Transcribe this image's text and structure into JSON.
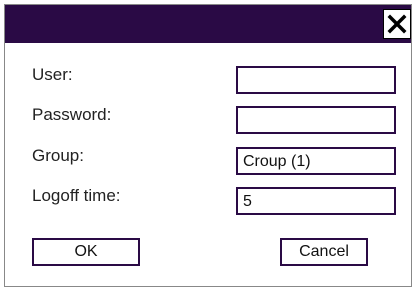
{
  "titlebar": {
    "close_icon": "close-icon"
  },
  "form": {
    "user_label": "User:",
    "user_value": "",
    "password_label": "Password:",
    "password_value": "",
    "group_label": "Group:",
    "group_value": "Croup (1)",
    "logoff_label": "Logoff time:",
    "logoff_value": "5"
  },
  "buttons": {
    "ok_label": "OK",
    "cancel_label": "Cancel"
  },
  "colors": {
    "titlebar": "#2a0a45",
    "field_border": "#2a0a45"
  }
}
